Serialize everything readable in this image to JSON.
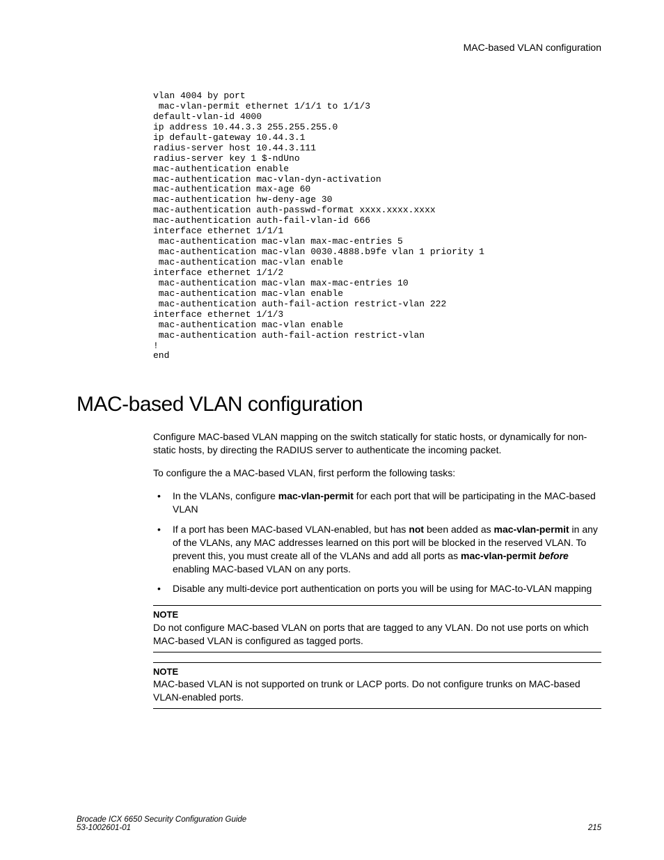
{
  "header": {
    "running": "MAC-based VLAN configuration"
  },
  "code": "vlan 4004 by port\n mac-vlan-permit ethernet 1/1/1 to 1/1/3\ndefault-vlan-id 4000\nip address 10.44.3.3 255.255.255.0\nip default-gateway 10.44.3.1\nradius-server host 10.44.3.111\nradius-server key 1 $-ndUno\nmac-authentication enable\nmac-authentication mac-vlan-dyn-activation\nmac-authentication max-age 60\nmac-authentication hw-deny-age 30\nmac-authentication auth-passwd-format xxxx.xxxx.xxxx\nmac-authentication auth-fail-vlan-id 666\ninterface ethernet 1/1/1\n mac-authentication mac-vlan max-mac-entries 5\n mac-authentication mac-vlan 0030.4888.b9fe vlan 1 priority 1\n mac-authentication mac-vlan enable\ninterface ethernet 1/1/2\n mac-authentication mac-vlan max-mac-entries 10\n mac-authentication mac-vlan enable\n mac-authentication auth-fail-action restrict-vlan 222\ninterface ethernet 1/1/3\n mac-authentication mac-vlan enable\n mac-authentication auth-fail-action restrict-vlan\n!\nend",
  "section": {
    "title": "MAC-based VLAN configuration"
  },
  "intro": {
    "p1": "Configure MAC-based VLAN mapping on the switch statically for static hosts, or dynamically for non-static hosts, by directing the RADIUS server to authenticate the incoming packet.",
    "p2": "To configure the a MAC-based VLAN, first perform the following tasks:"
  },
  "bullets": {
    "b1_a": "In the VLANs, configure ",
    "b1_bold": "mac-vlan-permit",
    "b1_b": " for each port that will be participating in the MAC-based VLAN",
    "b2_a": "If a port has been MAC-based VLAN-enabled, but has ",
    "b2_bold1": "not",
    "b2_b": " been added as ",
    "b2_bold2": "mac-vlan-permit",
    "b2_c": " in any of the VLANs, any MAC addresses learned on this port will be blocked in the reserved VLAN. To prevent this, you must create all of the VLANs and add all ports as ",
    "b2_bold3": "mac-vlan-permit",
    "b2_d": " ",
    "b2_ital": "before",
    "b2_e": " enabling MAC-based VLAN on any ports.",
    "b3": "Disable any multi-device port authentication on ports you will be using for MAC-to-VLAN mapping"
  },
  "notes": {
    "label": "NOTE",
    "n1": "Do not configure MAC-based VLAN on ports that are tagged to any VLAN. Do not use ports on which MAC-based VLAN is configured as tagged ports.",
    "n2": "MAC-based VLAN is not supported on trunk or LACP ports. Do not configure trunks on MAC-based VLAN-enabled ports."
  },
  "footer": {
    "line1": "Brocade ICX 6650 Security Configuration Guide",
    "line2": "53-1002601-01",
    "page": "215"
  }
}
